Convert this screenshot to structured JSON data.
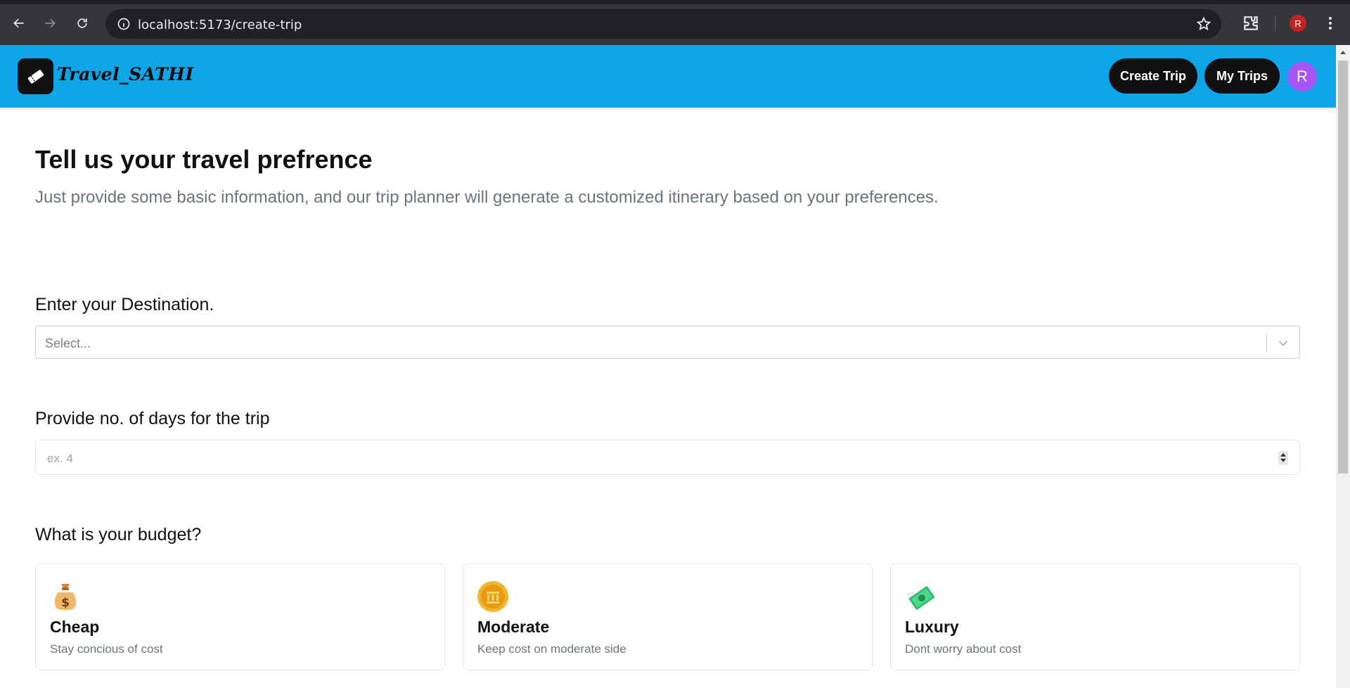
{
  "browser": {
    "url": "localhost:5173/create-trip",
    "profile_initial": "R",
    "icons": [
      "back-icon",
      "forward-icon",
      "reload-icon",
      "site-info-icon",
      "star-icon",
      "extensions-icon",
      "menu-kebab-icon"
    ]
  },
  "header": {
    "brand": "Travel_SATHI",
    "create_trip": "Create Trip",
    "my_trips": "My Trips",
    "avatar_initial": "R",
    "colors": {
      "bar": "#0ea5e9",
      "button": "#111111",
      "avatar": "#a855f7"
    }
  },
  "main": {
    "title": "Tell us your travel prefrence",
    "subtitle": "Just provide some basic information, and our trip planner will generate a customized itinerary based on your preferences.",
    "destination": {
      "label": "Enter your Destination.",
      "placeholder": "Select..."
    },
    "days": {
      "label": "Provide no. of days for the trip",
      "placeholder": "ex. 4"
    },
    "budget": {
      "label": "What is your budget?",
      "options": [
        {
          "title": "Cheap",
          "desc": "Stay concious of cost",
          "icon": "money-bag-icon"
        },
        {
          "title": "Moderate",
          "desc": "Keep cost on moderate side",
          "icon": "coin-icon"
        },
        {
          "title": "Luxury",
          "desc": "Dont worry about cost",
          "icon": "money-with-wings-icon"
        }
      ]
    }
  }
}
